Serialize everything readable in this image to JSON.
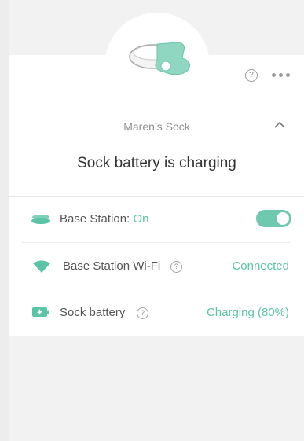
{
  "header": {
    "help_glyph": "?",
    "sock_name": "Maren’s Sock",
    "status_title": "Sock battery is charging"
  },
  "rows": [
    {
      "icon": "base-station-icon",
      "label": "Base Station:",
      "state": "On",
      "toggle_on": true
    },
    {
      "icon": "wifi-icon",
      "label": "Base Station Wi-Fi",
      "help_glyph": "?",
      "value": "Connected"
    },
    {
      "icon": "battery-charging-icon",
      "label": "Sock battery",
      "help_glyph": "?",
      "value": "Charging (80%)"
    }
  ],
  "colors": {
    "accent": "#5cc4a6",
    "toggle": "#6fc9ae",
    "background": "#f2f2f2"
  }
}
